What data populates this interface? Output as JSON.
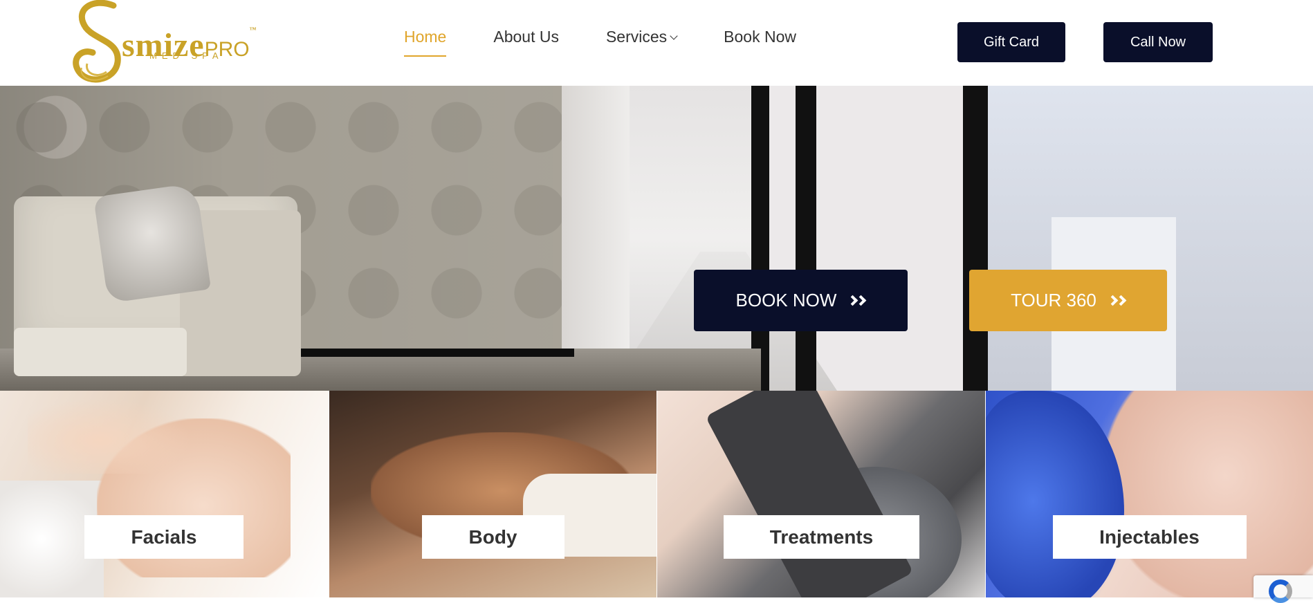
{
  "brand": {
    "name": "smize",
    "name_suffix": "PRO",
    "subtitle": "MED SPA",
    "color": "#c9a227"
  },
  "nav": {
    "items": [
      {
        "label": "Home",
        "active": true
      },
      {
        "label": "About Us",
        "active": false
      },
      {
        "label": "Services",
        "active": false,
        "has_dropdown": true
      },
      {
        "label": "Book Now",
        "active": false
      }
    ]
  },
  "header_buttons": {
    "gift_card": "Gift Card",
    "call_now": "Call Now"
  },
  "hero": {
    "book_now": "BOOK NOW",
    "tour": "TOUR 360"
  },
  "services": [
    {
      "label": "Facials"
    },
    {
      "label": "Body"
    },
    {
      "label": "Treatments"
    },
    {
      "label": "Injectables"
    }
  ],
  "colors": {
    "navy": "#0a0f2a",
    "gold": "#e0a531",
    "accent_nav": "#e0a52b"
  }
}
